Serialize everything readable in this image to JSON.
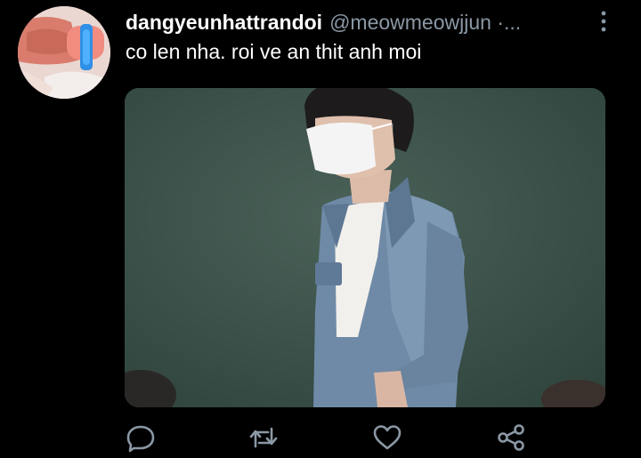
{
  "tweet": {
    "display_name": "dangyeunhattrandoi",
    "handle": "@meowmeowjjun ·...",
    "text": "co len nha. roi ve an thit anh moi"
  },
  "icons": {
    "more": "more-vertical-icon",
    "reply": "reply-icon",
    "retweet": "retweet-icon",
    "like": "heart-icon",
    "share": "share-icon"
  },
  "colors": {
    "background": "#000000",
    "primary_text": "#ffffff",
    "secondary_text": "#8b98a5",
    "action_icon": "#8b98a5"
  }
}
